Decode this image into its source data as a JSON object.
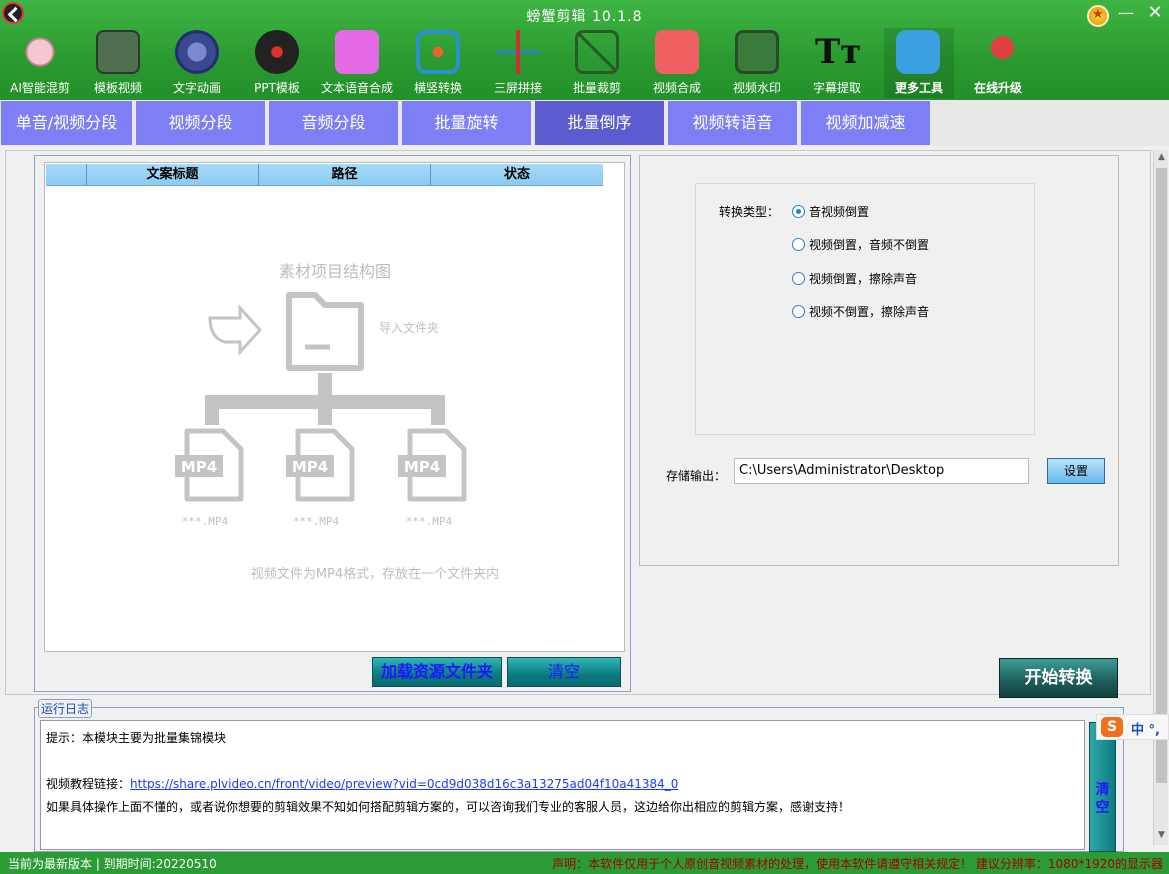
{
  "window": {
    "title": "螃蟹剪辑 10.1.8",
    "minimize": "—",
    "close": "✕"
  },
  "toolbar": [
    {
      "label": "AI智能混剪",
      "icon": "ai-mix-icon",
      "color": "#e8b4c0"
    },
    {
      "label": "模板视频",
      "icon": "template-video-icon",
      "color": "#5a7a5a"
    },
    {
      "label": "文字动画",
      "icon": "text-animation-icon",
      "color": "#4a5aa0"
    },
    {
      "label": "PPT模板",
      "icon": "ppt-template-icon",
      "color": "#222222"
    },
    {
      "label": "文本语音合成",
      "icon": "text-to-speech-icon",
      "color": "#e070e0"
    },
    {
      "label": "横竖转换",
      "icon": "orientation-convert-icon",
      "color": "#2a90d0"
    },
    {
      "label": "三屏拼接",
      "icon": "triple-screen-icon",
      "color": "#2a8aa0"
    },
    {
      "label": "批量裁剪",
      "icon": "batch-crop-icon",
      "color": "#4a8a4a"
    },
    {
      "label": "视频合成",
      "icon": "video-compose-icon",
      "color": "#f06060"
    },
    {
      "label": "视频水印",
      "icon": "video-watermark-icon",
      "color": "#3a5a3a"
    },
    {
      "label": "字幕提取",
      "icon": "subtitle-extract-icon",
      "color": "#1a1a1a"
    },
    {
      "label": "更多工具",
      "icon": "more-tools-icon",
      "color": "#3aa0e0"
    },
    {
      "label": "在线升级",
      "icon": "online-upgrade-icon",
      "color": "#e04040"
    }
  ],
  "tabs": [
    "单音/视频分段",
    "视频分段",
    "音频分段",
    "批量旋转",
    "批量倒序",
    "视频转语音",
    "视频加减速"
  ],
  "file_table": {
    "columns": [
      "文案标题",
      "路径",
      "状态"
    ],
    "rows": []
  },
  "placeholder": {
    "title": "素材项目结构图",
    "import_label": "导入文件夹",
    "file_caption": "***.MP4",
    "mp4_badge": "MP4",
    "hint": "视频文件为MP4格式，存放在一个文件夹内"
  },
  "buttons": {
    "load": "加载资源文件夹",
    "clear": "清空",
    "settings": "设置",
    "start": "开始转换",
    "log_clear": "清空"
  },
  "convert": {
    "label": "转换类型：",
    "options": [
      "音视频倒置",
      "视频倒置，音频不倒置",
      "视频倒置，擦除声音",
      "视频不倒置，擦除声音"
    ],
    "selected_index": 0
  },
  "output": {
    "label": "存储输出：",
    "path": "C:\\Users\\Administrator\\Desktop"
  },
  "log": {
    "legend": "运行日志",
    "line1": "提示：本模块主要为批量集锦模块",
    "link_label": "视频教程链接：",
    "link_url": "https://share.plvideo.cn/front/video/preview?vid=0cd9d038d16c3a13275ad04f10a41384_0",
    "line3": "如果具体操作上面不懂的，或者说你想要的剪辑效果不知如何搭配剪辑方案的，可以咨询我们专业的客服人员，这边给你出相应的剪辑方案，感谢支持！"
  },
  "ime": {
    "logo": "S",
    "text": "中 °,"
  },
  "status": {
    "left": "当前为最新版本 | 到期时间:20220510",
    "right": "声明：本软件仅用于个人原创音视频素材的处理，使用本软件请遵守相关规定！ 建议分辨率：1080*1920的显示器"
  },
  "colors": {
    "title_bar": "#2a9a30",
    "tab": "#7f7ff5",
    "tab_active": "#5c5cd0",
    "button_teal": "#0b7a82",
    "status_right": "#a00000"
  }
}
